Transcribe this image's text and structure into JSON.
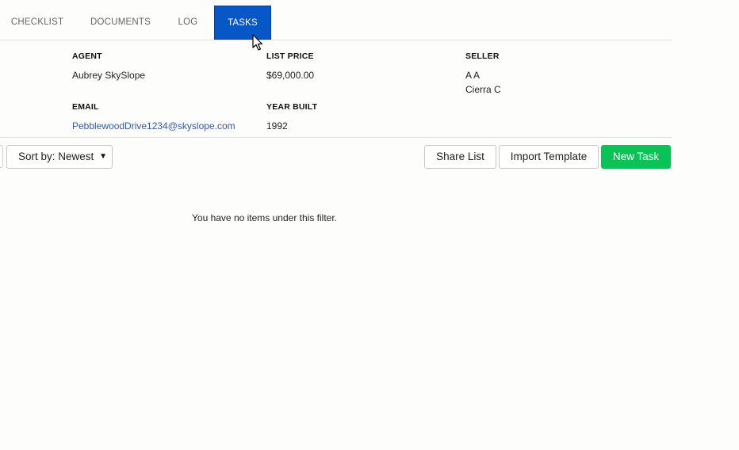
{
  "tabs": {
    "checklist": "CHECKLIST",
    "documents": "DOCUMENTS",
    "log": "LOG",
    "tasks": "TASKS"
  },
  "details": {
    "agent_label": "AGENT",
    "agent_value": "Aubrey SkySlope",
    "list_price_label": "LIST PRICE",
    "list_price_value": "$69,000.00",
    "seller_label": "SELLER",
    "seller_values": [
      "A A",
      "Cierra C"
    ],
    "email_label": "EMAIL",
    "email_value": "PebblewoodDrive1234@skyslope.com",
    "year_built_label": "YEAR BUILT",
    "year_built_value": "1992"
  },
  "toolbar": {
    "sort_label": "Sort by: Newest",
    "share_label": "Share List",
    "import_label": "Import Template",
    "new_task_label": "New Task"
  },
  "empty_message": "You have no items under this filter.",
  "colors": {
    "active_tab": "#0757c8",
    "new_task": "#0bc256",
    "link": "#2f5aa7"
  },
  "icons": {
    "sort_caret": "caret-down-icon",
    "cursor": "mouse-pointer-icon"
  }
}
